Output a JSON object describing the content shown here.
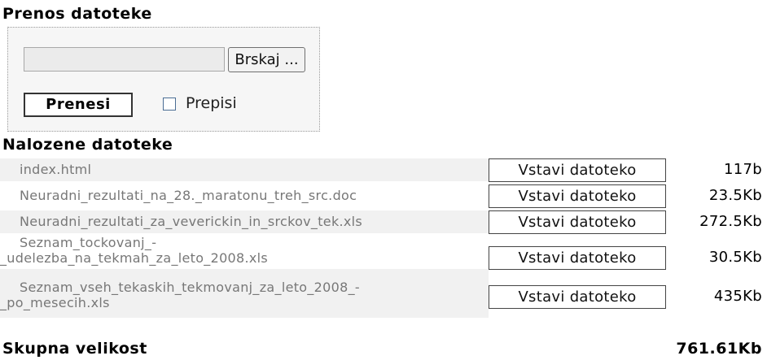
{
  "upload": {
    "heading": "Prenos datoteke",
    "browse_label": "Brskaj ...",
    "file_value": "",
    "upload_label": "Prenesi",
    "overwrite_label": "Prepisi",
    "overwrite_checked": false
  },
  "files": {
    "heading": "Nalozene datoteke",
    "insert_label": "Vstavi datoteko",
    "rows": [
      {
        "name_line1": "index.html",
        "name_line2": "",
        "size": "117b"
      },
      {
        "name_line1": "Neuradni_rezultati_na_28._maratonu_treh_src.doc",
        "name_line2": "",
        "size": "23.5Kb"
      },
      {
        "name_line1": "Neuradni_rezultati_za_veverickin_in_srckov_tek.xls",
        "name_line2": "",
        "size": "272.5Kb"
      },
      {
        "name_line1": "Seznam_tockovanj_-",
        "name_line2": "_udelezba_na_tekmah_za_leto_2008.xls",
        "size": "30.5Kb"
      },
      {
        "name_line1": "Seznam_vseh_tekaskih_tekmovanj_za_leto_2008_-",
        "name_line2": "_po_mesecih.xls",
        "size": "435Kb"
      }
    ]
  },
  "total": {
    "label": "Skupna velikost",
    "value": "761.61Kb"
  }
}
